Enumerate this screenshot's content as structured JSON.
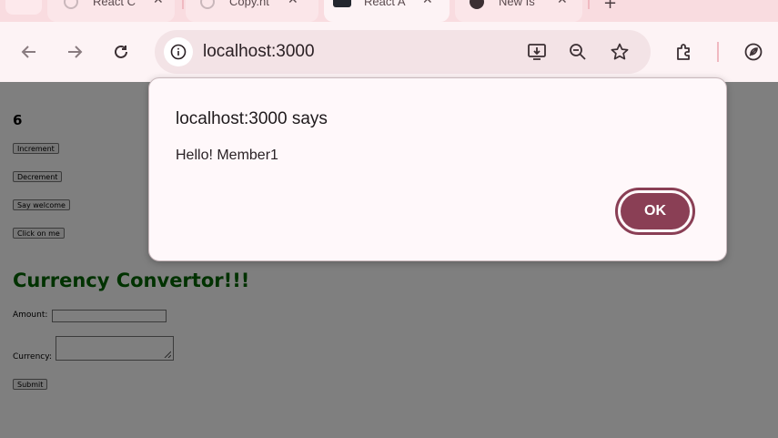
{
  "browser": {
    "tabs": [
      {
        "title": "React C",
        "favicon": "openai-icon"
      },
      {
        "title": "Copy.ht",
        "favicon": "openai-icon"
      },
      {
        "title": "React A",
        "favicon": "react-icon"
      },
      {
        "title": "New Is",
        "favicon": "github-icon"
      }
    ],
    "url": "localhost:3000"
  },
  "page": {
    "counter": "6",
    "buttons": {
      "increment": "Increment",
      "decrement": "Decrement",
      "welcome": "Say welcome",
      "click": "Click on me",
      "submit": "Submit"
    },
    "currency": {
      "heading": "Currency Convertor!!!",
      "amount_label": "Amount:",
      "currency_label": "Currency:"
    }
  },
  "dialog": {
    "title": "localhost:3000 says",
    "message": "Hello! Member1",
    "ok_label": "OK"
  },
  "colors": {
    "accent": "#8a3f55",
    "heading": "#006400",
    "chrome_bg": "#fdf3f5",
    "tabstrip_bg": "#f9dce0"
  }
}
